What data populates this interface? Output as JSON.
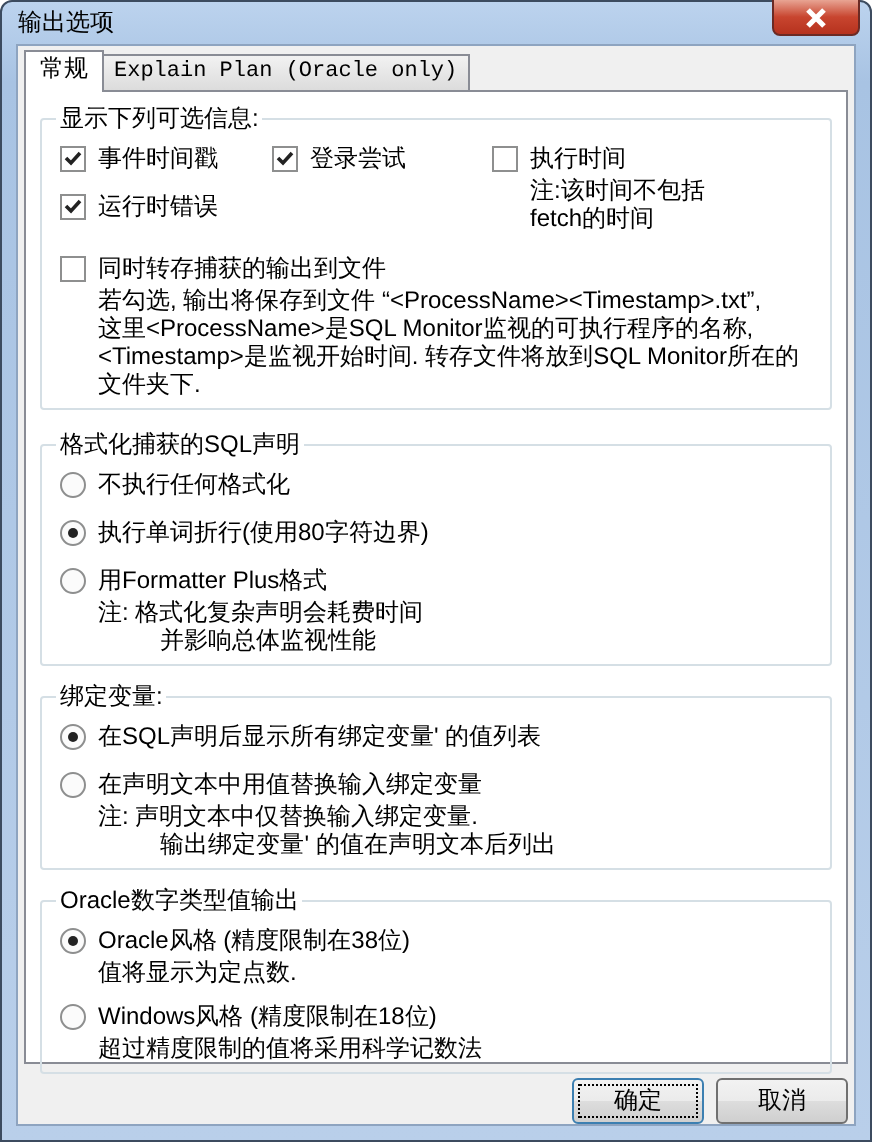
{
  "window": {
    "title": "输出选项"
  },
  "tabs": [
    {
      "label": "常规",
      "selected": true
    },
    {
      "label": "Explain Plan (Oracle only)",
      "selected": false
    }
  ],
  "groups": [
    {
      "title": "显示下列可选信息:",
      "items": [
        {
          "kind": "checkbox",
          "label": "事件时间戳",
          "checked": true
        },
        {
          "kind": "checkbox",
          "label": "运行时错误",
          "checked": true
        },
        {
          "kind": "checkbox",
          "label": "登录尝试",
          "checked": true
        },
        {
          "kind": "checkbox",
          "label": "执行时间",
          "checked": false,
          "note": [
            "注:该时间不包括",
            "fetch的时间"
          ]
        },
        {
          "kind": "checkbox",
          "label": "同时转存捕获的输出到文件",
          "checked": false,
          "note": [
            "若勾选, 输出将保存到文件 “<ProcessName><Timestamp>.txt”,",
            "这里<ProcessName>是SQL Monitor监视的可执行程序的名称,",
            "<Timestamp>是监视开始时间. 转存文件将放到SQL Monitor所在的",
            "文件夹下."
          ]
        }
      ]
    },
    {
      "title": "格式化捕获的SQL声明",
      "items": [
        {
          "kind": "radio",
          "label": "不执行任何格式化",
          "selected": false
        },
        {
          "kind": "radio",
          "label": "执行单词折行(使用80字符边界)",
          "selected": true
        },
        {
          "kind": "radio",
          "label": "用Formatter Plus格式",
          "selected": false,
          "note": [
            "注: 格式化复杂声明会耗费时间",
            "并影响总体监视性能"
          ]
        }
      ]
    },
    {
      "title": "绑定变量:",
      "items": [
        {
          "kind": "radio",
          "label": "在SQL声明后显示所有绑定变量' 的值列表",
          "selected": true
        },
        {
          "kind": "radio",
          "label": "在声明文本中用值替换输入绑定变量",
          "selected": false,
          "note": [
            "注: 声明文本中仅替换输入绑定变量.",
            "输出绑定变量' 的值在声明文本后列出"
          ]
        }
      ]
    },
    {
      "title": "Oracle数字类型值输出",
      "items": [
        {
          "kind": "radio",
          "label": "Oracle风格 (精度限制在38位)",
          "selected": true,
          "note": [
            "值将显示为定点数."
          ]
        },
        {
          "kind": "radio",
          "label": "Windows风格 (精度限制在18位)",
          "selected": false,
          "note": [
            "超过精度限制的值将采用科学记数法"
          ]
        }
      ]
    }
  ],
  "buttons": [
    {
      "label": "确定",
      "default": true
    },
    {
      "label": "取消",
      "default": false
    }
  ]
}
